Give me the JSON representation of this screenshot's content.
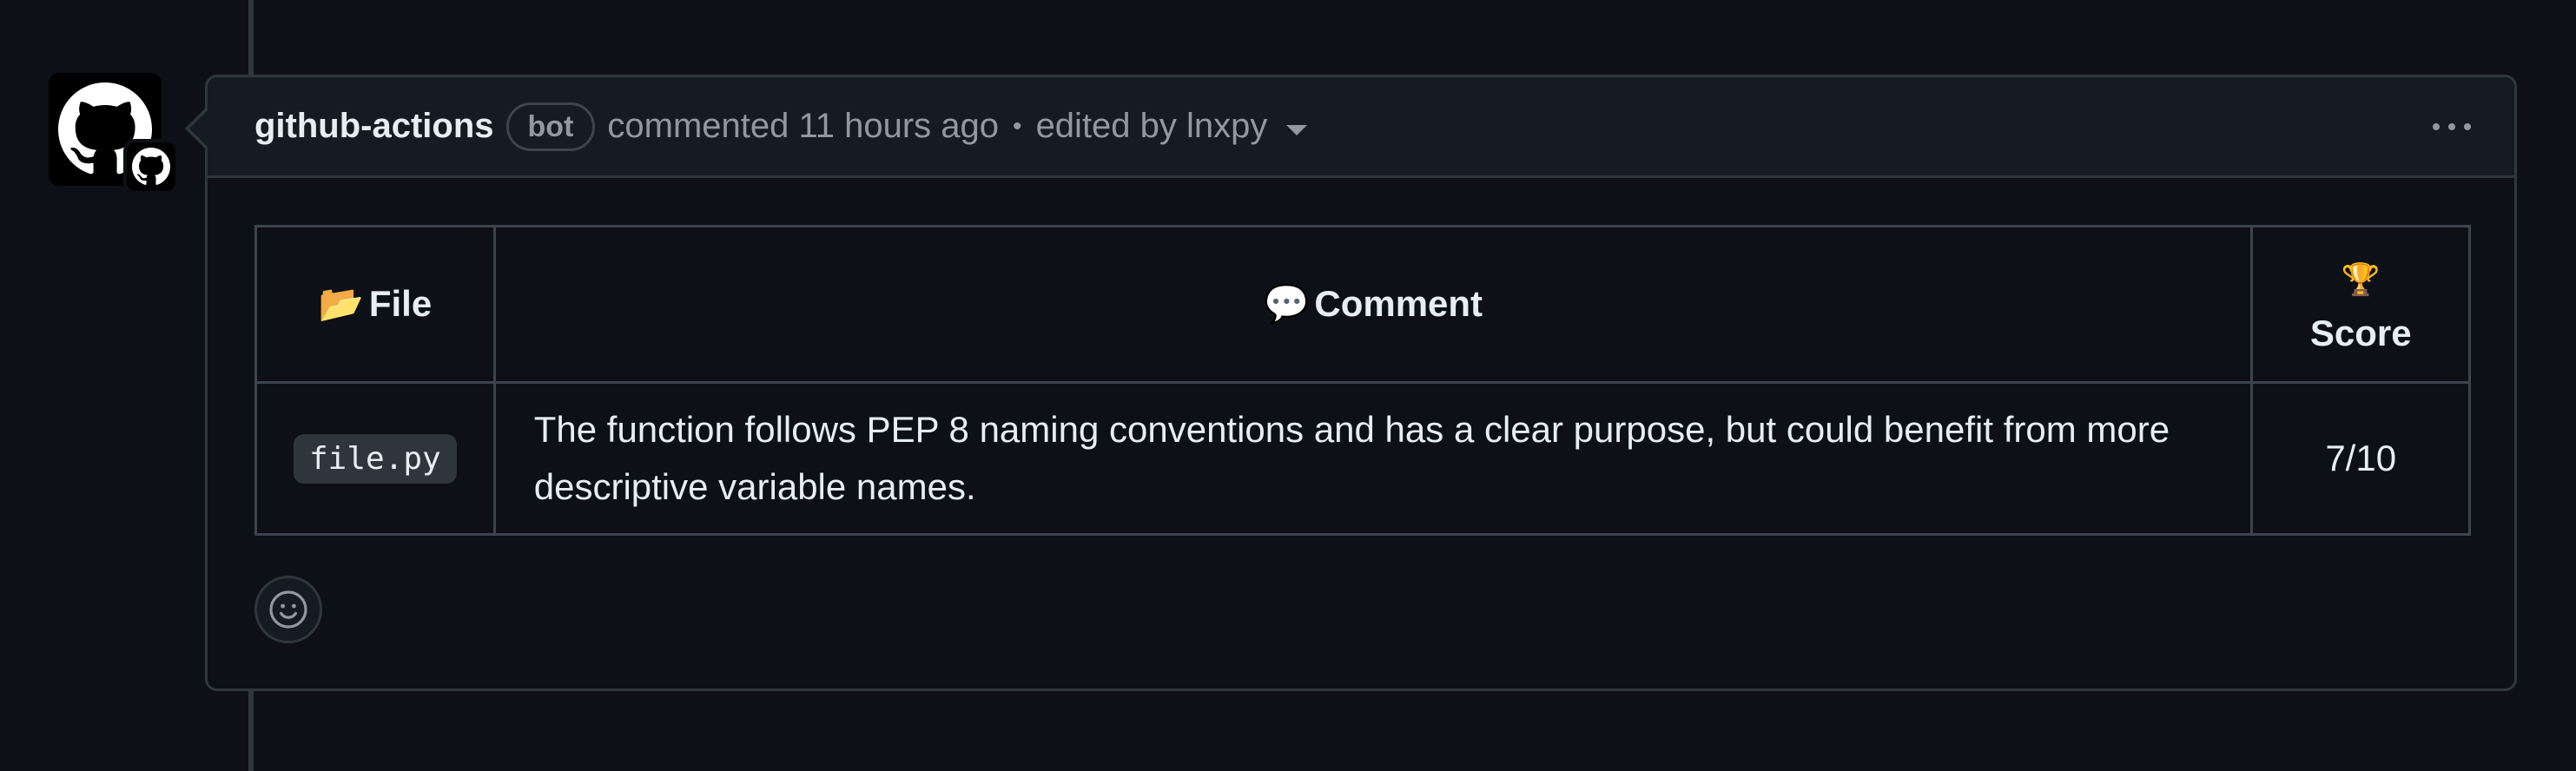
{
  "comment": {
    "author": "github-actions",
    "author_badge": "bot",
    "action_text": "commented 11 hours ago",
    "separator": "•",
    "edited_text": "edited by lnxpy"
  },
  "icons": {
    "avatar": "github-octocat-icon",
    "avatar_badge": "github-app-badge-icon",
    "menu": "kebab-horizontal-icon",
    "edit_history": "triangle-down-icon",
    "reaction": "smiley-icon"
  },
  "table": {
    "headers": {
      "file_emoji": "📂",
      "file_label": "File",
      "comment_emoji": "💬",
      "comment_label": "Comment",
      "score_emoji": "🏆",
      "score_label": "Score"
    },
    "rows": [
      {
        "file": "file.py",
        "comment": "The function follows PEP 8 naming conventions and has a clear purpose, but could benefit from more descriptive variable names.",
        "score": "7/10"
      }
    ]
  },
  "colors": {
    "background": "#0d1117",
    "header_bg": "#151b23",
    "border": "#30363d",
    "text_primary": "#e6edf3",
    "text_muted": "#9198a1"
  }
}
